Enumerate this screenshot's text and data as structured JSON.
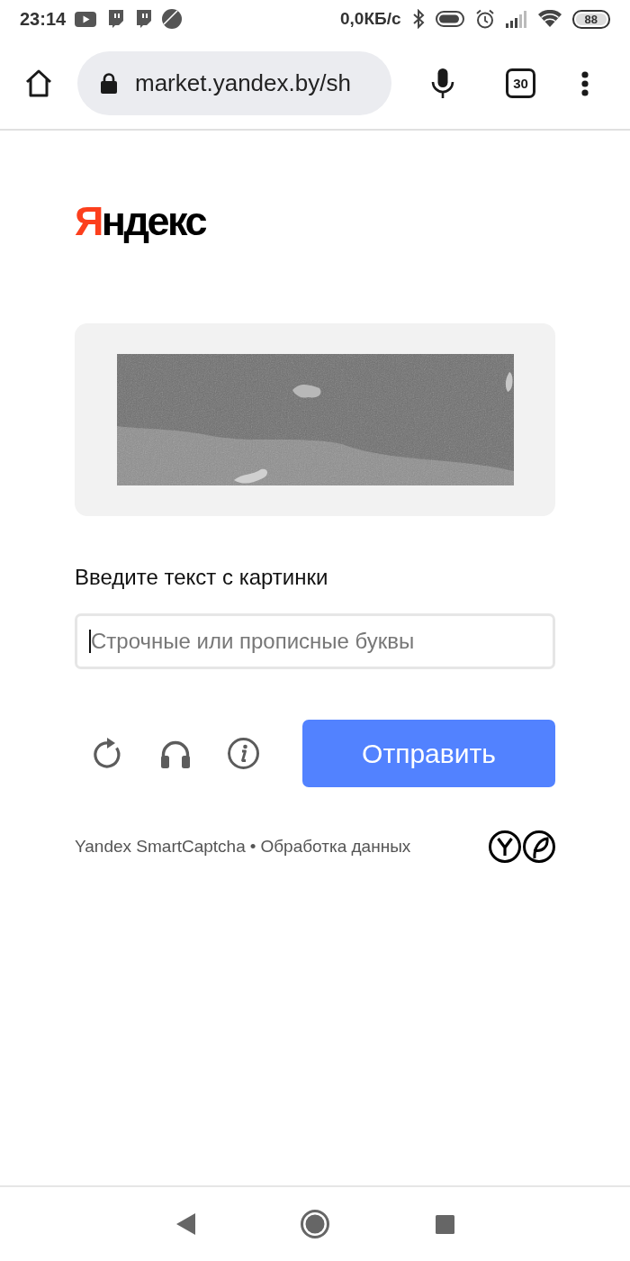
{
  "status_bar": {
    "time": "23:14",
    "network_speed": "0,0КБ/с",
    "battery": "88"
  },
  "browser": {
    "url": "market.yandex.by/sh",
    "tab_count": "30"
  },
  "logo": "Яндекс",
  "captcha": {
    "prompt": "Введите текст с картинки",
    "input": {
      "placeholder": "Строчные или прописные буквы",
      "focused": true
    },
    "submit": "Отправить"
  },
  "footer": {
    "brand": "Yandex SmartCaptcha",
    "separator": "•",
    "link": "Обработка данных"
  }
}
